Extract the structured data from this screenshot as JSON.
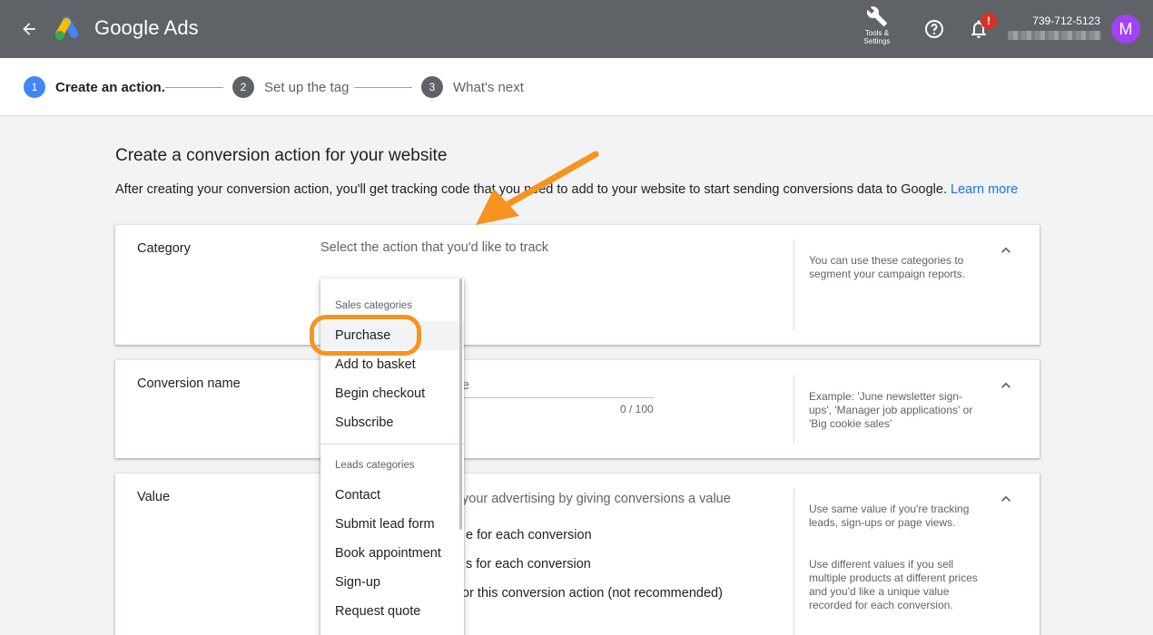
{
  "header": {
    "brand": "Google Ads",
    "tools_label": "Tools & Settings",
    "notification_badge": "!",
    "account_id": "739-712-5123",
    "avatar_initial": "M"
  },
  "stepper": {
    "steps": [
      {
        "num": "1",
        "label": "Create an action."
      },
      {
        "num": "2",
        "label": "Set up the tag"
      },
      {
        "num": "3",
        "label": "What's next"
      }
    ]
  },
  "page": {
    "title": "Create a conversion action for your website",
    "description": "After creating your conversion action, you'll get tracking code that you need to add to your website to start sending conversions data to Google.",
    "learn_more": "Learn more"
  },
  "category": {
    "label": "Category",
    "prompt": "Select the action that you'd like to track",
    "help": "You can use these categories to segment your campaign reports."
  },
  "conversion_name": {
    "label": "Conversion name",
    "placeholder_fragment": "e",
    "counter": "0 / 100",
    "help": "Example: 'June newsletter sign-ups', 'Manager job applications' or 'Big cookie sales'"
  },
  "value": {
    "label": "Value",
    "prompt_fragment": "your advertising by giving conversions a value",
    "options": [
      "e for each conversion",
      "s for each conversion",
      "or this conversion action (not recommended)"
    ],
    "help1": "Use same value if you're tracking leads, sign-ups or page views.",
    "help2": "Use different values if you sell multiple products at different prices and you'd like a unique value recorded for each conversion."
  },
  "dropdown": {
    "sales_header": "Sales categories",
    "sales_items": [
      "Purchase",
      "Add to basket",
      "Begin checkout",
      "Subscribe"
    ],
    "leads_header": "Leads categories",
    "leads_items": [
      "Contact",
      "Submit lead form",
      "Book appointment",
      "Sign-up",
      "Request quote"
    ]
  },
  "colors": {
    "topbar": "#5f6368",
    "accent_blue": "#4285f4",
    "link": "#1a73e8",
    "highlight_orange": "#f7931e",
    "avatar": "#a142f4",
    "badge_red": "#d93025"
  }
}
